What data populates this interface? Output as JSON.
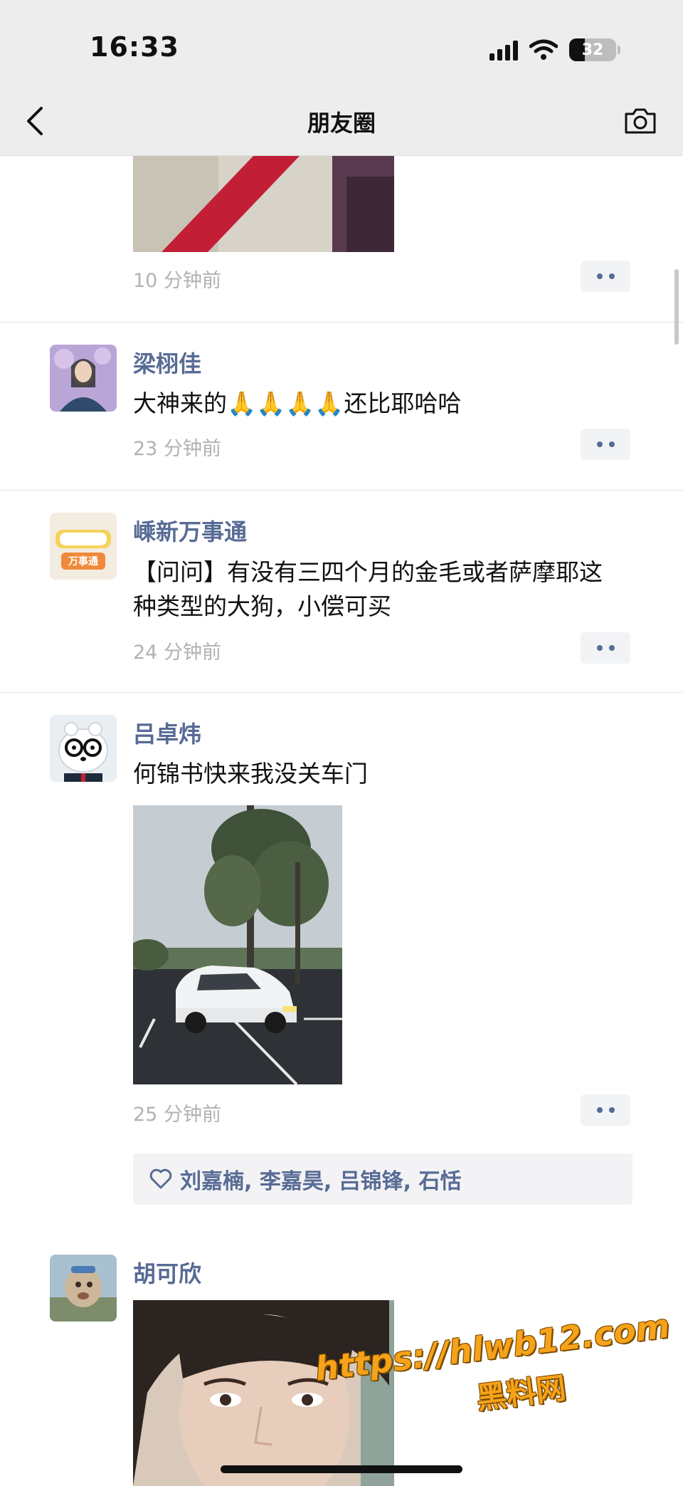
{
  "status_bar": {
    "time": "16:33",
    "battery": "32"
  },
  "nav": {
    "title": "朋友圈"
  },
  "posts": [
    {
      "time": "10 分钟前"
    },
    {
      "author": "梁栩佳",
      "text_before": "大神来的",
      "emoji": "🙏🙏🙏🙏",
      "text_after": "还比耶哈哈",
      "time": "23 分钟前"
    },
    {
      "author": "嵊新万事通",
      "text": "【问问】有没有三四个月的金毛或者萨摩耶这种类型的大狗，小偿可买",
      "time": "24 分钟前",
      "avatar_text": "万事通"
    },
    {
      "author": "吕卓炜",
      "text": "何锦书快来我没关车门",
      "time": "25 分钟前",
      "likes": "刘嘉楠, 李嘉昊, 吕锦锋, 石恬"
    },
    {
      "author": "胡可欣"
    }
  ],
  "watermark": {
    "url": "https://hlwb12.com",
    "name": "黑料网"
  },
  "colors": {
    "name_blue": "#576b95",
    "nav_bg": "#ededed",
    "time_grey": "#b2b2b2",
    "watermark": "#f6a21a"
  }
}
